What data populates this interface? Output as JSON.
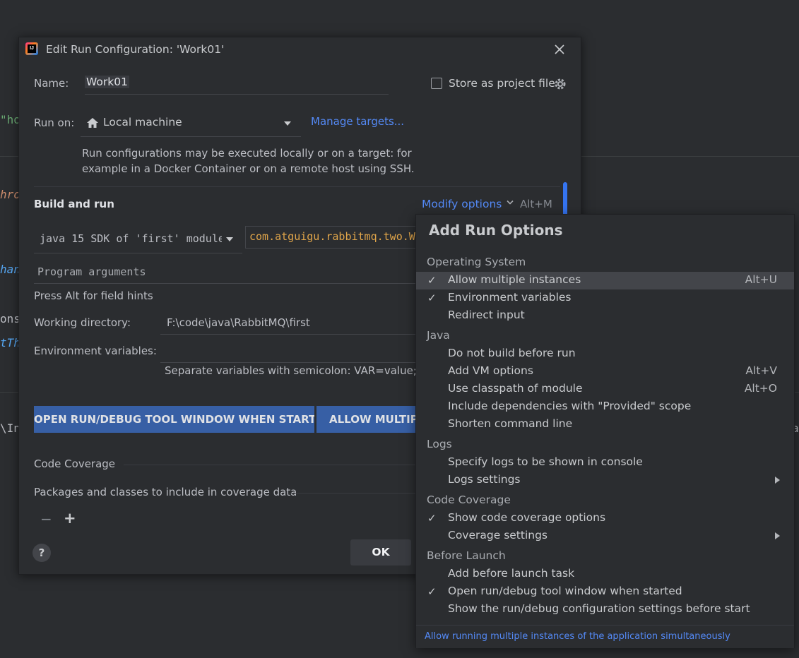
{
  "editor_fragments": [
    {
      "text": "\"ho",
      "color": "#6aab73"
    },
    {
      "text": "hro",
      "color": "#cf8e6d"
    },
    {
      "text": "han",
      "color": "#56a8f5"
    },
    {
      "text": "ons",
      "color": "#bcbec4"
    },
    {
      "text": "tTh",
      "color": "#56a8f5"
    },
    {
      "text": "\\Int",
      "color": "#bcbec4"
    },
    {
      "text": "a",
      "color": "#bcbec4"
    }
  ],
  "dialog": {
    "title": "Edit Run Configuration: 'Work01'",
    "name_label": "Name:",
    "name_value": "Work01",
    "store_label": "Store as project file",
    "run_on_label": "Run on:",
    "run_on_value": "Local machine",
    "manage_targets": "Manage targets...",
    "run_on_desc_1": "Run configurations may be executed locally or on a target: for",
    "run_on_desc_2": "example in a Docker Container or on a remote host using SSH.",
    "build_and_run": "Build and run",
    "modify_options": "Modify options",
    "modify_shortcut": "Alt+M",
    "sdk": "java 15 SDK of 'first' module",
    "main_class": "com.atguigu.rabbitmq.two.W",
    "program_args_placeholder": "Program arguments",
    "field_hint": "Press Alt for field hints",
    "working_dir_label": "Working directory:",
    "working_dir_value": "F:\\code\\java\\RabbitMQ\\first",
    "env_label": "Environment variables:",
    "env_hint": "Separate variables with semicolon: VAR=value; VA",
    "tag_open_tool": "OPEN RUN/DEBUG TOOL WINDOW WHEN STARTED",
    "tag_allow_multiple": "ALLOW MULTIPLE INSTANCES",
    "code_coverage": "Code Coverage",
    "packages_label": "Packages and classes to include in coverage data",
    "minus": "−",
    "plus": "+",
    "ok": "OK",
    "help": "?"
  },
  "popup": {
    "title": "Add Run Options",
    "groups": [
      {
        "label": "Operating System",
        "items": [
          {
            "label": "Allow multiple instances",
            "checked": true,
            "shortcut": "Alt+U",
            "selected": true
          },
          {
            "label": "Environment variables",
            "checked": true
          },
          {
            "label": "Redirect input"
          }
        ]
      },
      {
        "label": "Java",
        "items": [
          {
            "label": "Do not build before run"
          },
          {
            "label": "Add VM options",
            "shortcut": "Alt+V"
          },
          {
            "label": "Use classpath of module",
            "shortcut": "Alt+O"
          },
          {
            "label": "Include dependencies with \"Provided\" scope"
          },
          {
            "label": "Shorten command line"
          }
        ]
      },
      {
        "label": "Logs",
        "items": [
          {
            "label": "Specify logs to be shown in console"
          },
          {
            "label": "Logs settings",
            "submenu": true
          }
        ]
      },
      {
        "label": "Code Coverage",
        "items": [
          {
            "label": "Show code coverage options",
            "checked": true
          },
          {
            "label": "Coverage settings",
            "submenu": true
          }
        ]
      },
      {
        "label": "Before Launch",
        "items": [
          {
            "label": "Add before launch task"
          },
          {
            "label": "Open run/debug tool window when started",
            "checked": true
          },
          {
            "label": "Show the run/debug configuration settings before start"
          }
        ]
      }
    ],
    "footer": "Allow running multiple instances of the application simultaneously"
  }
}
